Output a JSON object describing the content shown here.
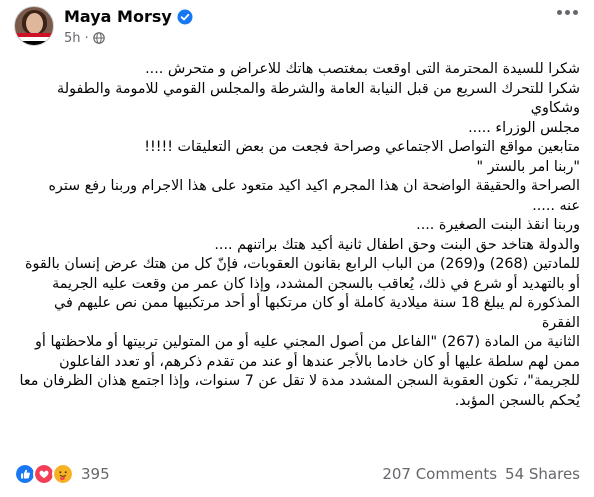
{
  "author": {
    "name": "Maya Morsy",
    "time": "5h",
    "separator": "·"
  },
  "icons": {
    "verified": "verified-badge-icon",
    "audience": "globe-icon",
    "more": "more-options-icon",
    "reactions": [
      "like-icon",
      "love-icon",
      "care-icon"
    ]
  },
  "colors": {
    "verified": "#1877f2",
    "like": "#1877f2",
    "love": "#f33e58",
    "care": "#f7b125",
    "meta_text": "#65676b"
  },
  "post": {
    "lines": [
      "شكرا للسيدة المحترمة التى اوقعت بمغتصب هاتك للاعراض  و متحرش ....",
      "شكرا للتحرك السريع من قبل النيابة العامة والشرطة والمجلس القومي للامومة والطفولة وشكاوي",
      "مجلس الوزراء .....",
      "متابعين مواقع التواصل الاجتماعي وصراحة فجعت من بعض التعليقات !!!!!",
      "\"ربنا امر بالستر \"",
      "الصراحة والحقيقة الواضحة ان هذا المجرم اكيد اكيد متعود على هذا الاجرام وربنا  رفع ستره",
      "عنه .....",
      "وربنا انقذ البنت الصغيرة ....",
      "والدولة هتاخد حق البنت وحق اطفال ثانية أكيد هتك براتنهم ....",
      "للمادتين (268) و(269) من الباب الرابع بقانون العقوبات، فإنّ كل من هتك عرض إنسان بالقوة",
      "أو بالتهديد أو شرع في ذلك، يُعاقب بالسجن المشدد، وإذا كان عمر من وقعت عليه الجريمة",
      "المذكورة لم يبلغ 18 سنة ميلادية كاملة أو كان مرتكبها أو أحد مرتكبيها ممن نص عليهم في الفقرة",
      "الثانية من المادة (267) \"الفاعل من أصول المجني عليه أو من المتولين تربيتها أو ملاحظتها أو",
      "ممن لهم سلطة عليها أو كان خادما بالأجر عندها أو عند من تقدم ذكرهم، أو تعدد الفاعلون",
      "للجريمة\"، تكون العقوبة السجن المشدد مدة لا تقل عن 7 سنوات، وإذا اجتمع هذان الظرفان معا",
      "يُحكم بالسجن المؤبد."
    ]
  },
  "engagement": {
    "reactions_count": "395",
    "comments": "207 Comments",
    "shares": "54 Shares"
  }
}
